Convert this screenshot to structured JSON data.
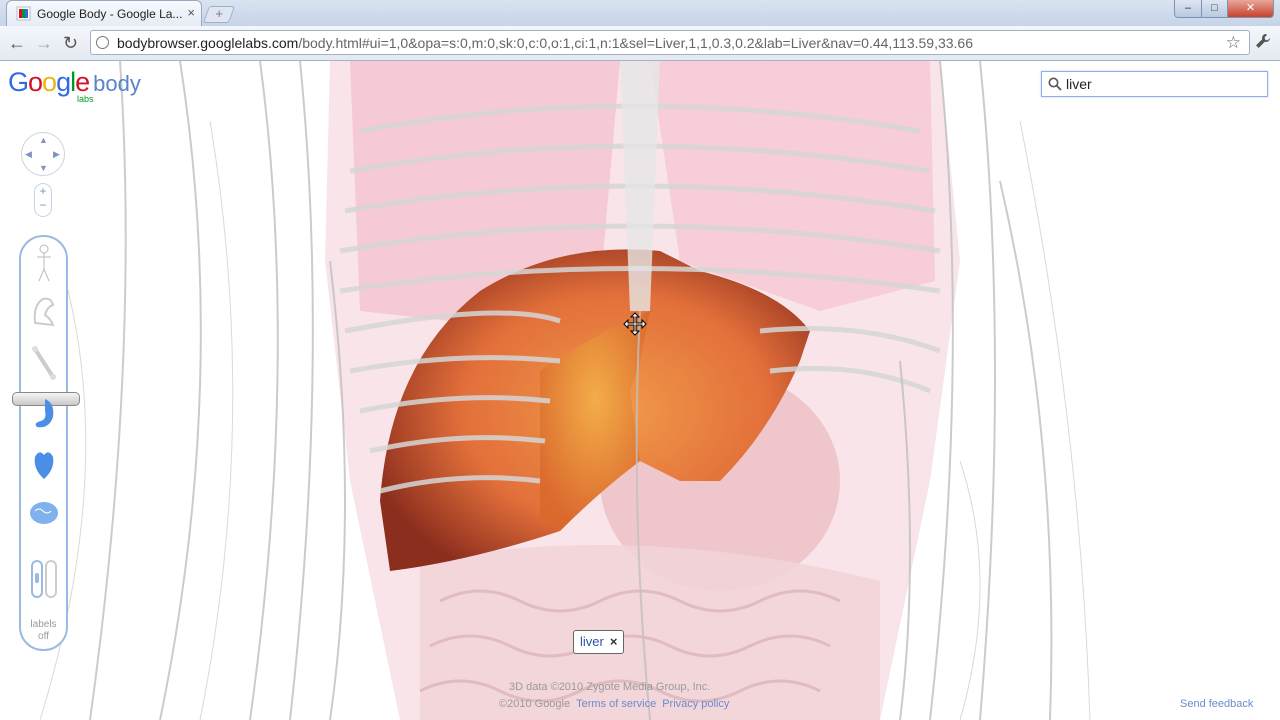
{
  "browser": {
    "tab_title": "Google Body - Google La...",
    "tab_close": "×",
    "new_tab": "+",
    "url_host": "bodybrowser.googlelabs.com",
    "url_path": "/body.html#ui=1,0&opa=s:0,m:0,sk:0,c:0,o:1,ci:1,n:1&sel=Liver,1,1,0.3,0.2&lab=Liver&nav=0.44,113.59,33.66",
    "back": "←",
    "forward": "→",
    "reload": "↻",
    "star": "☆",
    "wrench": "🔧",
    "min": "–",
    "max": "□",
    "close": "✕"
  },
  "app": {
    "logo_letters": [
      "G",
      "o",
      "o",
      "g",
      "l",
      "e"
    ],
    "logo_body": "body",
    "logo_labs": "labs",
    "search_value": "liver",
    "labels_text_1": "labels",
    "labels_text_2": "off",
    "selected_chip": "liver",
    "chip_close": "×",
    "credits_line1": "3D data ©2010 Zygote Media Group, Inc.",
    "credits_copyright": "©2010 Google",
    "terms_link": "Terms of service",
    "privacy_link": "Privacy policy",
    "feedback_link": "Send feedback",
    "layers": [
      "skin-layer-icon",
      "muscle-layer-icon",
      "bone-layer-icon",
      "organ-layer-icon",
      "circulatory-layer-icon",
      "nervous-layer-icon"
    ],
    "colors": {
      "accent": "#9cb9e3",
      "link": "#6a8ccf",
      "liver": "#e5773a",
      "organ_pink": "#f2b8c6"
    }
  }
}
